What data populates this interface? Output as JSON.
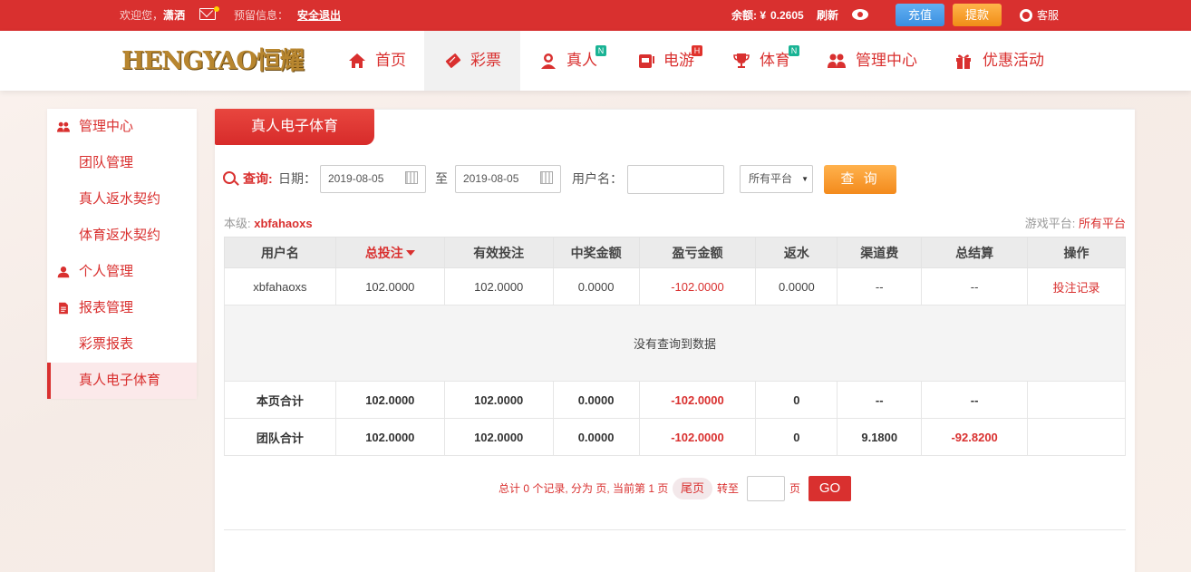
{
  "topbar": {
    "welcome": "欢迎您，",
    "username": "潇洒",
    "reserved_info": "预留信息：",
    "logout": "安全退出",
    "balance_label": "余额: ¥",
    "balance_value": "0.2605",
    "refresh": "刷新",
    "recharge": "充值",
    "withdraw": "提款",
    "service": "客服",
    "color": "#d9302f"
  },
  "logo": {
    "text": "HENGYAO恒耀"
  },
  "nav": {
    "items": [
      {
        "label": "首页",
        "icon": "home-icon"
      },
      {
        "label": "彩票",
        "icon": "ticket-icon",
        "active": true
      },
      {
        "label": "真人",
        "icon": "dealer-icon",
        "badge": "N"
      },
      {
        "label": "电游",
        "icon": "slot-machine-icon",
        "badge": "H"
      },
      {
        "label": "体育",
        "icon": "trophy-icon",
        "badge": "N"
      },
      {
        "label": "管理中心",
        "icon": "users-icon"
      },
      {
        "label": "优惠活动",
        "icon": "gift-icon"
      }
    ]
  },
  "sidebar": {
    "items": [
      {
        "label": "管理中心",
        "icon": "users-icon"
      },
      {
        "label": "团队管理"
      },
      {
        "label": "真人返水契约"
      },
      {
        "label": "体育返水契约"
      },
      {
        "label": "个人管理",
        "icon": "user-icon"
      },
      {
        "label": "报表管理",
        "icon": "report-icon"
      },
      {
        "label": "彩票报表"
      },
      {
        "label": "真人电子体育",
        "active": true
      }
    ]
  },
  "panel": {
    "title": "真人电子体育",
    "query_label": "查询:",
    "date_label": "日期：",
    "date_from": "2019-08-05",
    "to_label": "至",
    "date_to": "2019-08-05",
    "username_label": "用户名：",
    "username_value": "",
    "platform_select": "所有平台",
    "query_button": "查 询",
    "level_label": "本级:",
    "level_user": "xbfahaoxs",
    "platform_label": "游戏平台:",
    "platform_value": "所有平台"
  },
  "table": {
    "headers": [
      "用户名",
      "总投注",
      "有效投注",
      "中奖金额",
      "盈亏金额",
      "返水",
      "渠道费",
      "总结算",
      "操作"
    ],
    "rows": [
      [
        "xbfahaoxs",
        "102.0000",
        "102.0000",
        "0.0000",
        "-102.0000",
        "0.0000",
        "--",
        "--",
        "投注记录"
      ]
    ],
    "empty_message": "没有查询到数据",
    "page_total": [
      "本页合计",
      "102.0000",
      "102.0000",
      "0.0000",
      "-102.0000",
      "0",
      "--",
      "--",
      ""
    ],
    "team_total": [
      "团队合计",
      "102.0000",
      "102.0000",
      "0.0000",
      "-102.0000",
      "0",
      "9.1800",
      "-92.8200",
      ""
    ]
  },
  "pager": {
    "summary": "总计 0 个记录, 分为 页, 当前第 1 页",
    "last": "尾页",
    "goto": "转至",
    "page_input": "",
    "page_unit": "页",
    "go": "GO"
  }
}
